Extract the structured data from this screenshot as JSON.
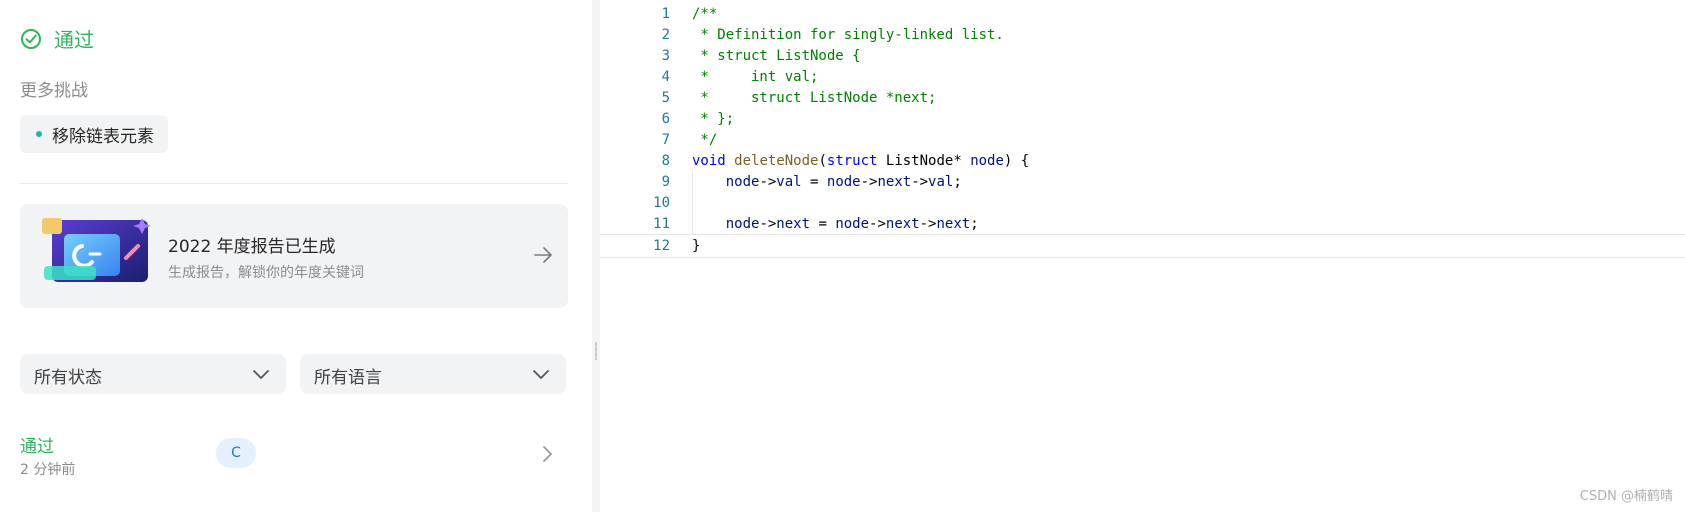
{
  "result": {
    "status": "通过"
  },
  "more_challenges": {
    "title": "更多挑战",
    "items": [
      {
        "label": "移除链表元素"
      }
    ]
  },
  "report_banner": {
    "title": "2022 年度报告已生成",
    "subtitle": "生成报告，解锁你的年度关键词"
  },
  "filters": {
    "status_select": {
      "value": "所有状态"
    },
    "language_select": {
      "value": "所有语言"
    }
  },
  "submissions": [
    {
      "result": "通过",
      "time": "2 分钟前",
      "language": "C"
    }
  ],
  "editor": {
    "lines": [
      [
        {
          "t": "/**",
          "c": "com"
        }
      ],
      [
        {
          "t": " * Definition for singly-linked list.",
          "c": "com"
        }
      ],
      [
        {
          "t": " * struct ListNode {",
          "c": "com"
        }
      ],
      [
        {
          "t": " *     int val;",
          "c": "com"
        }
      ],
      [
        {
          "t": " *     struct ListNode *next;",
          "c": "com"
        }
      ],
      [
        {
          "t": " * };",
          "c": "com"
        }
      ],
      [
        {
          "t": " */",
          "c": "com"
        }
      ],
      [
        {
          "t": "void",
          "c": "kw"
        },
        {
          "t": " ",
          "c": "plain"
        },
        {
          "t": "deleteNode",
          "c": "fn"
        },
        {
          "t": "(",
          "c": "plain"
        },
        {
          "t": "struct",
          "c": "kw"
        },
        {
          "t": " ListNode* ",
          "c": "plain"
        },
        {
          "t": "node",
          "c": "var"
        },
        {
          "t": ") {",
          "c": "plain"
        }
      ],
      [
        {
          "t": "    ",
          "c": "plain"
        },
        {
          "t": "node",
          "c": "var"
        },
        {
          "t": "->",
          "c": "plain"
        },
        {
          "t": "val",
          "c": "var"
        },
        {
          "t": " = ",
          "c": "plain"
        },
        {
          "t": "node",
          "c": "var"
        },
        {
          "t": "->",
          "c": "plain"
        },
        {
          "t": "next",
          "c": "var"
        },
        {
          "t": "->",
          "c": "plain"
        },
        {
          "t": "val",
          "c": "var"
        },
        {
          "t": ";",
          "c": "plain"
        }
      ],
      [],
      [
        {
          "t": "    ",
          "c": "plain"
        },
        {
          "t": "node",
          "c": "var"
        },
        {
          "t": "->",
          "c": "plain"
        },
        {
          "t": "next",
          "c": "var"
        },
        {
          "t": " = ",
          "c": "plain"
        },
        {
          "t": "node",
          "c": "var"
        },
        {
          "t": "->",
          "c": "plain"
        },
        {
          "t": "next",
          "c": "var"
        },
        {
          "t": "->",
          "c": "plain"
        },
        {
          "t": "next",
          "c": "var"
        },
        {
          "t": ";",
          "c": "plain"
        }
      ],
      [
        {
          "t": "}",
          "c": "plain"
        }
      ]
    ],
    "current_line": 12
  },
  "watermark": "CSDN @楠鹤晴",
  "colors": {
    "accepted": "#2db55d",
    "tag_dot": "#15bd9a",
    "lang_badge_bg": "#e4f0fd",
    "lang_badge_text": "#1a76d2"
  },
  "icons": {
    "status": "check-circle-icon",
    "banner_arrow": "arrow-right-icon",
    "dropdown": "chevron-down-icon",
    "row_arrow": "chevron-right-icon"
  }
}
